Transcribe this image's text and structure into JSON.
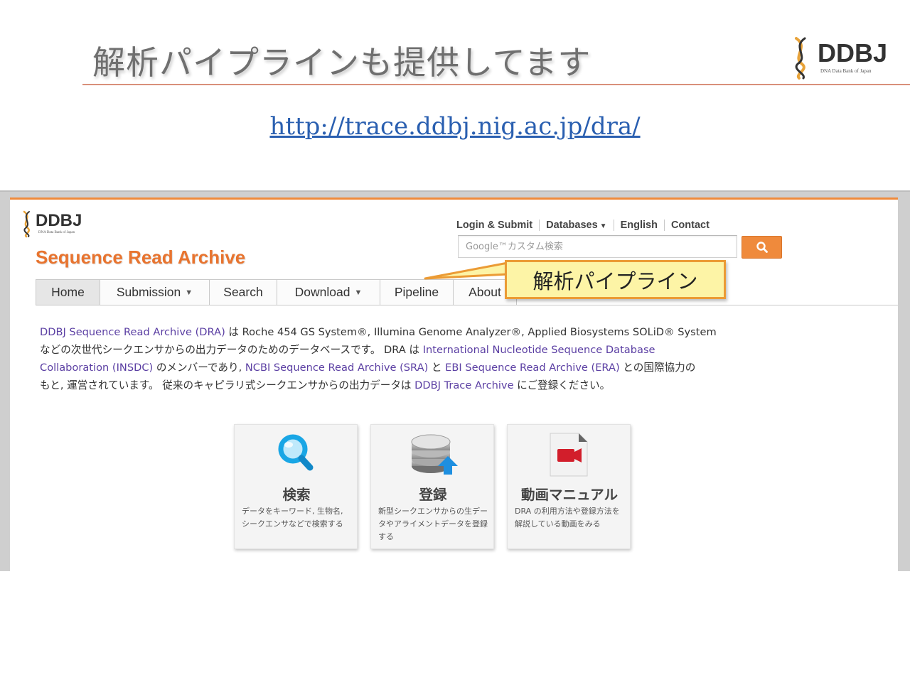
{
  "slide": {
    "title": "解析パイプラインも提供してます",
    "logo_text": "DDBJ",
    "logo_subtitle": "DNA Data Bank of Japan",
    "url": "http://trace.ddbj.nig.ac.jp/dra/",
    "accent_color": "#e8742f",
    "callout_text": "解析パイプライン"
  },
  "site": {
    "logo_text": "DDBJ",
    "logo_subtitle": "DNA Data Bank of Japan",
    "name": "Sequence Read Archive",
    "utility_nav": {
      "login": "Login & Submit",
      "databases": "Databases",
      "english": "English",
      "contact": "Contact"
    },
    "search": {
      "placeholder": "Google™カスタム検索",
      "button_icon": "search-icon"
    },
    "tabs": {
      "home": "Home",
      "submission": "Submission",
      "search": "Search",
      "download": "Download",
      "pipeline": "Pipeline",
      "about": "About"
    },
    "intro": {
      "l1_link": "DDBJ Sequence Read Archive (DRA)",
      "l1_text": " は Roche 454 GS System®, Illumina Genome Analyzer®, Applied Biosystems SOLiD® System",
      "l2_text": "などの次世代シークエンサからの出力データのためのデータベースです。 DRA は ",
      "l2_link": "International Nucleotide Sequence Database",
      "l3_link1": "Collaboration (INSDC)",
      "l3_text1": " のメンバーであり, ",
      "l3_link2": "NCBI Sequence Read Archive (SRA)",
      "l3_text2": " と ",
      "l3_link3": "EBI Sequence Read Archive (ERA)",
      "l3_text3": " との国際協力の",
      "l4_text": "もと, 運営されています。 従来のキャピラリ式シークエンサからの出力データは ",
      "l4_link": "DDBJ Trace Archive",
      "l4_text2": " にご登録ください。"
    },
    "cards": {
      "search": {
        "title": "検索",
        "desc": "データをキーワード, 生物名, シークエンサなどで検索する"
      },
      "submit": {
        "title": "登録",
        "desc": "新型シークエンサからの生データやアライメントデータを登録する"
      },
      "video": {
        "title": "動画マニュアル",
        "desc": "DRA の利用方法や登録方法を解説している動画をみる"
      }
    },
    "colors": {
      "orange": "#ef8a3c",
      "link": "#5b3fa3"
    }
  }
}
